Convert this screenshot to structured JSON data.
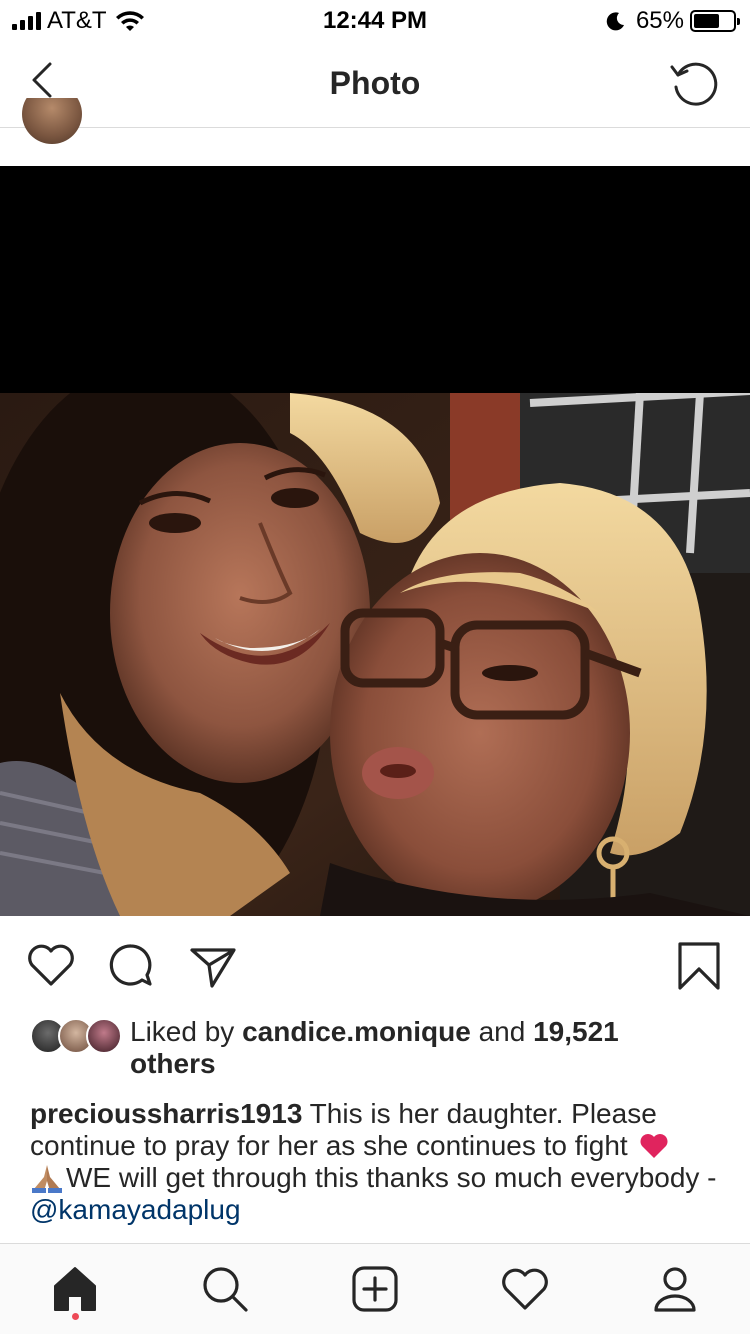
{
  "status_bar": {
    "carrier": "AT&T",
    "time": "12:44 PM",
    "battery_percent": "65%",
    "battery_level": 0.65,
    "signal_bars": 4
  },
  "nav": {
    "title": "Photo",
    "back_icon": "chevron-left-icon",
    "refresh_icon": "refresh-icon"
  },
  "post": {
    "image_description_icon": "photo",
    "actions": {
      "like_icon": "heart-outline-icon",
      "comment_icon": "comment-icon",
      "share_icon": "direct-share-icon",
      "save_icon": "bookmark-icon"
    },
    "likes": {
      "prefix": "Liked by ",
      "user": "candice.monique",
      "middle": " and ",
      "count": "19,521",
      "suffix": "others"
    },
    "caption": {
      "username": "precioussharris1913",
      "text_1": "This is her daughter. Please continue to pray for her as she continues to fight",
      "text_2": "WE will get through this thanks so much everybody -",
      "mention": "@kamayadaplug"
    }
  },
  "tab_bar": {
    "items": [
      "home-icon",
      "search-icon",
      "new-post-icon",
      "activity-icon",
      "profile-icon"
    ],
    "active": "home-icon",
    "notification_dot_color": "#ed4956"
  },
  "colors": {
    "text": "#262626",
    "mention": "#003569",
    "divider": "#dbdbdb",
    "heart_emoji": "#e0245e"
  }
}
